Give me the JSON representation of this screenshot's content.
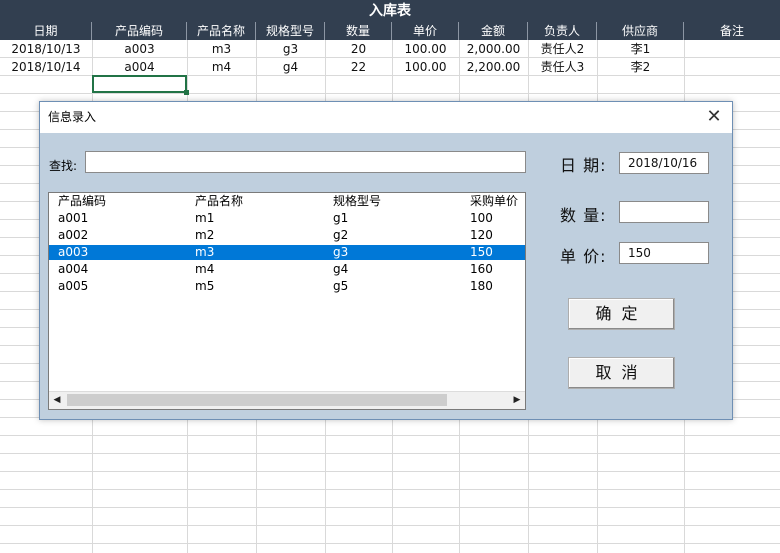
{
  "sheet": {
    "title": "入库表",
    "headers": [
      "日期",
      "产品编码",
      "产品名称",
      "规格型号",
      "数量",
      "单价",
      "金额",
      "负责人",
      "供应商",
      "备注"
    ],
    "rows": [
      [
        "2018/10/13",
        "a003",
        "m3",
        "g3",
        "20",
        "100.00",
        "2,000.00",
        "责任人2",
        "李1",
        ""
      ],
      [
        "2018/10/14",
        "a004",
        "m4",
        "g4",
        "22",
        "100.00",
        "2,200.00",
        "责任人3",
        "李2",
        ""
      ]
    ],
    "colors": {
      "header_bg": "#323f50",
      "selection": "#217346"
    }
  },
  "dialog": {
    "title": "信息录入",
    "close_icon": "close-icon",
    "search_label": "查找:",
    "search_value": "",
    "list": {
      "headers": [
        "产品编码",
        "产品名称",
        "规格型号",
        "采购单价"
      ],
      "rows": [
        [
          "a001",
          "m1",
          "g1",
          "100"
        ],
        [
          "a002",
          "m2",
          "g2",
          "120"
        ],
        [
          "a003",
          "m3",
          "g3",
          "150"
        ],
        [
          "a004",
          "m4",
          "g4",
          "160"
        ],
        [
          "a005",
          "m5",
          "g5",
          "180"
        ]
      ],
      "selected_index": 2
    },
    "date_label": "日 期:",
    "date_value": "2018/10/16",
    "qty_label": "数 量:",
    "qty_value": "",
    "price_label": "单 价:",
    "price_value": "150",
    "ok_label": "确定",
    "cancel_label": "取消",
    "colors": {
      "bg": "#bfcfde",
      "selected_row": "#0078d7"
    }
  }
}
